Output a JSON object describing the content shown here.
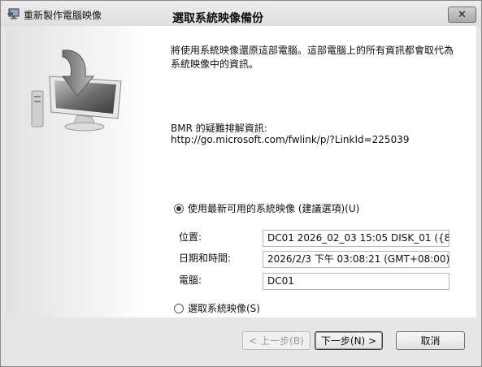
{
  "window": {
    "title": "重新製作電腦映像"
  },
  "page": {
    "heading": "選取系統映像備份",
    "description": "將使用系統映像還原這部電腦。這部電腦上的所有資訊都會取代為系統映像中的資訊。",
    "bmr_label": "BMR 的疑難排解資訊:",
    "bmr_link": "http://go.microsoft.com/fwlink/p/?LinkId=225039"
  },
  "options": {
    "latest_label": "使用最新可用的系統映像 (建議選項)(U)",
    "latest_selected": true,
    "select_label": "選取系統映像(S)",
    "select_selected": false
  },
  "details": {
    "location_label": "位置:",
    "location_value": "DC01 2026_02_03 15:05 DISK_01 ({8A38C",
    "datetime_label": "日期和時間:",
    "datetime_value": "2026/2/3 下午 03:08:21 (GMT+08:00)",
    "computer_label": "電腦:",
    "computer_value": "DC01"
  },
  "buttons": {
    "back": "< 上一步(B)",
    "next": "下一步(N) >",
    "cancel": "取消"
  },
  "icons": {
    "close": "close-icon",
    "app": "restore-app-icon",
    "hero": "monitor-restore-icon"
  }
}
